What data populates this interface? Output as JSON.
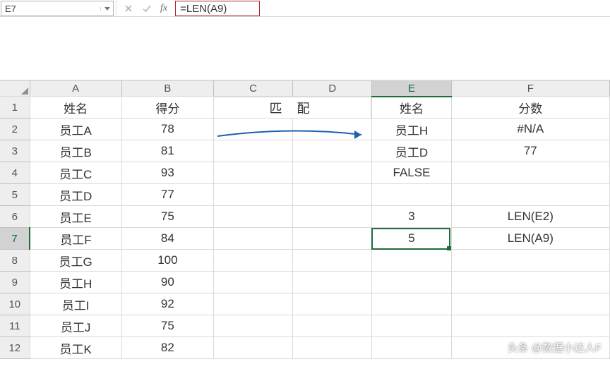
{
  "formula_bar": {
    "name_box": "E7",
    "formula": "=LEN(A9)"
  },
  "columns": [
    "A",
    "B",
    "C",
    "D",
    "E",
    "F"
  ],
  "row_headers": [
    "1",
    "2",
    "3",
    "4",
    "5",
    "6",
    "7",
    "8",
    "9",
    "10",
    "11",
    "12"
  ],
  "active_cell": {
    "col": "E",
    "row": 7
  },
  "merged_label": "匹  配",
  "cells": {
    "A": [
      "姓名",
      "员工A",
      "员工B",
      "员工C",
      "员工D",
      "员工E",
      "员工F",
      "员工G",
      "员工H",
      "员工I",
      "员工J",
      "员工K"
    ],
    "B": [
      "得分",
      "78",
      "81",
      "93",
      "77",
      "75",
      "84",
      "100",
      "90",
      "92",
      "75",
      "82"
    ],
    "E": [
      "姓名",
      "员工H",
      "员工D",
      "FALSE",
      "",
      "3",
      "5",
      "",
      "",
      "",
      "",
      ""
    ],
    "F": [
      "分数",
      "#N/A",
      "77",
      "",
      "",
      "LEN(E2)",
      "LEN(A9)",
      "",
      "",
      "",
      "",
      ""
    ]
  },
  "alignment": {
    "F0": "left",
    "F5": "left",
    "F6": "left",
    "E5": "right",
    "E6": "right"
  },
  "watermark": "头条 @数据小达人F",
  "chart_data": {
    "type": "table",
    "title": "",
    "columns": [
      "姓名",
      "得分"
    ],
    "rows": [
      [
        "员工A",
        78
      ],
      [
        "员工B",
        81
      ],
      [
        "员工C",
        93
      ],
      [
        "员工D",
        77
      ],
      [
        "员工E",
        75
      ],
      [
        "员工F",
        84
      ],
      [
        "员工G",
        100
      ],
      [
        "员工H",
        90
      ],
      [
        "员工I",
        92
      ],
      [
        "员工J",
        75
      ],
      [
        "员工K",
        82
      ]
    ],
    "lookup": {
      "姓名": [
        "员工H",
        "员工D"
      ],
      "分数": [
        "#N/A",
        77
      ]
    },
    "len_results": {
      "LEN(E2)": 3,
      "LEN(A9)": 5
    }
  }
}
